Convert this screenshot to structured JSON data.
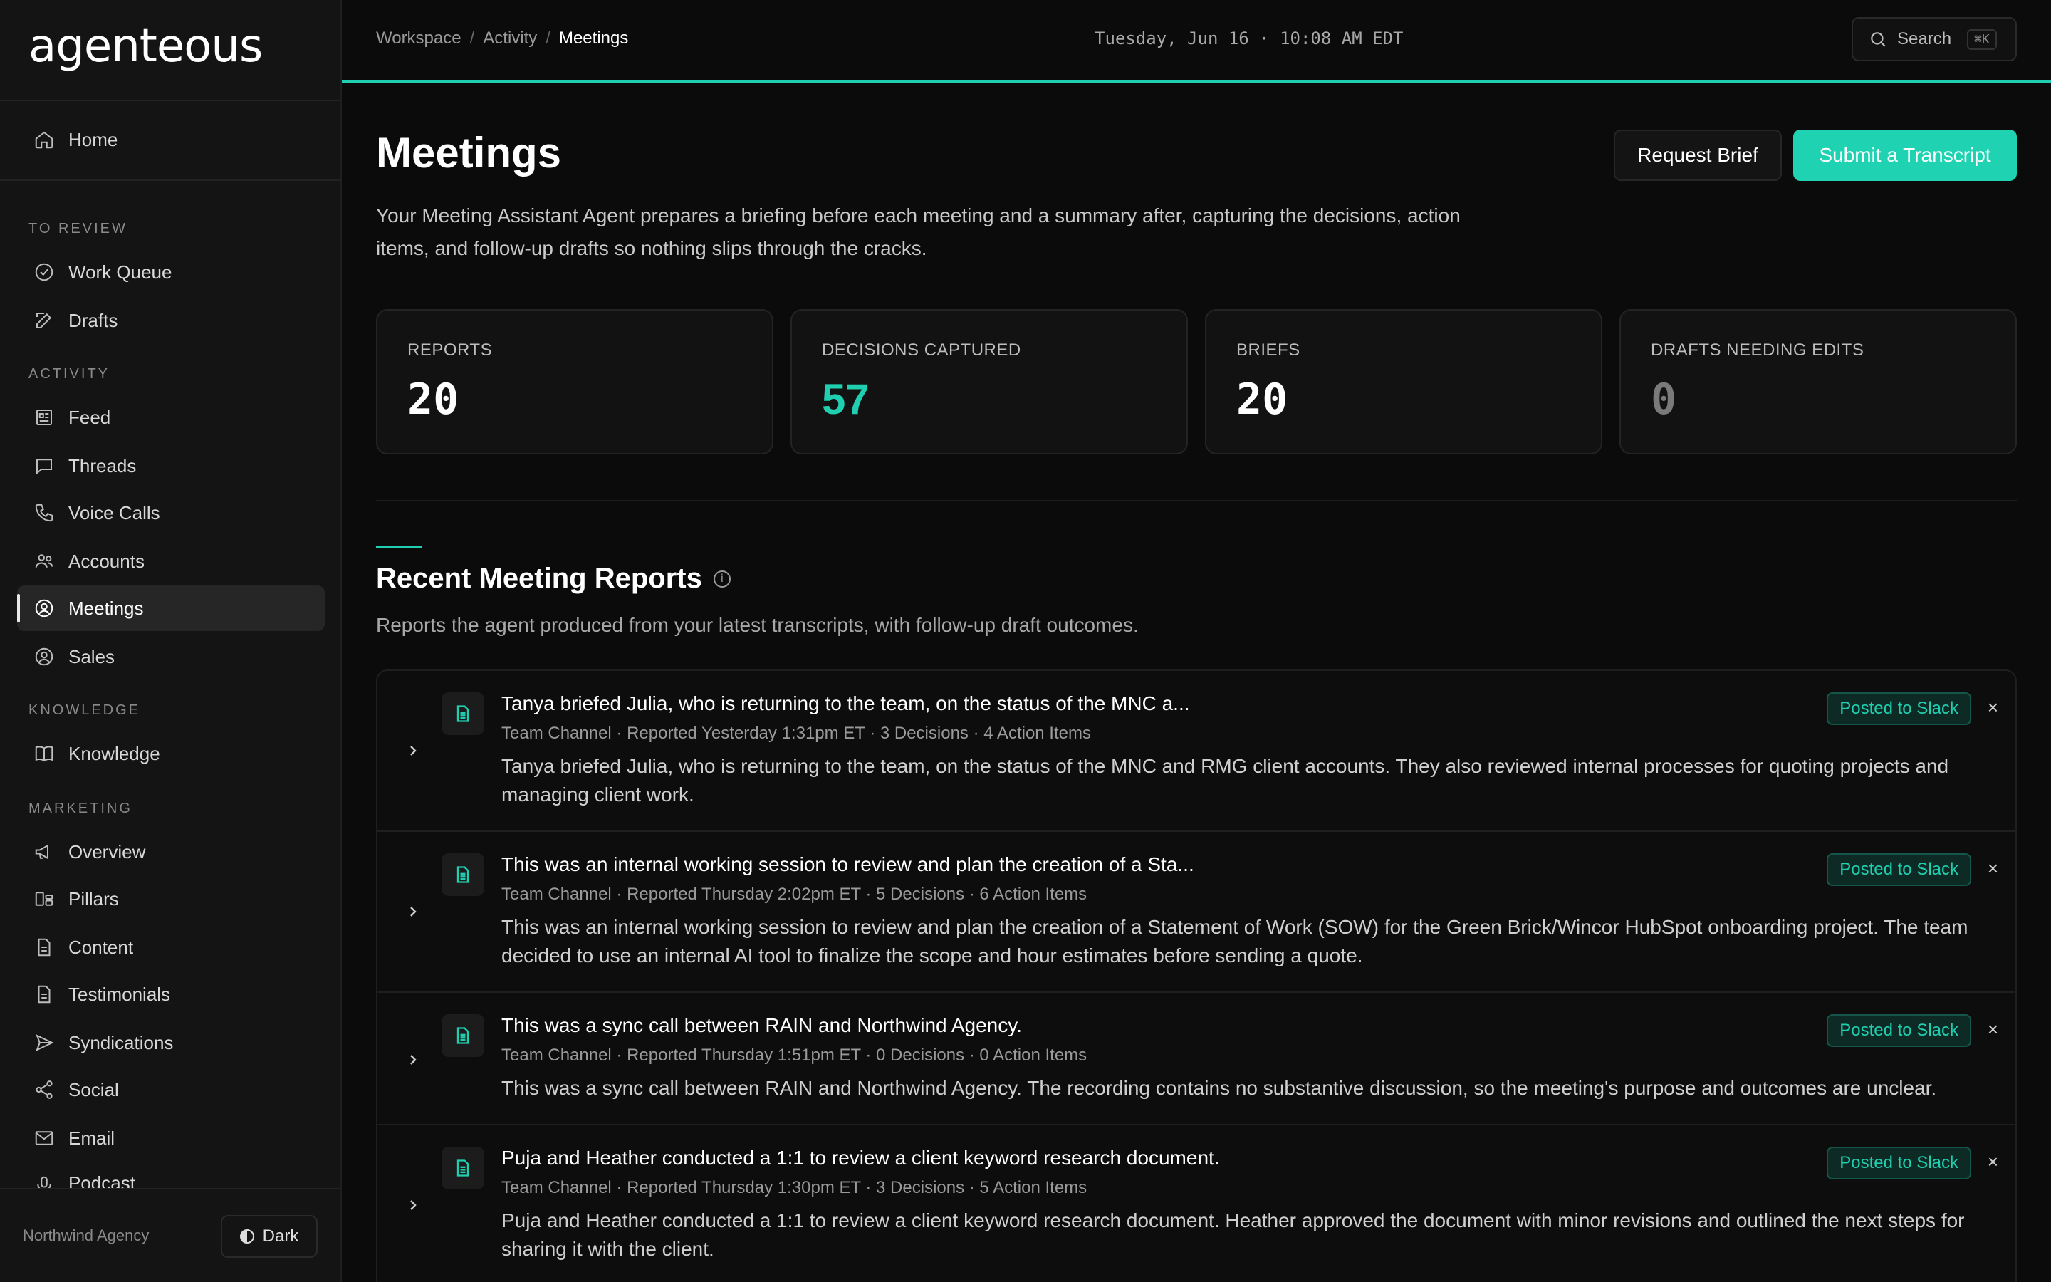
{
  "app": {
    "logo": "agenteous",
    "org_name": "Northwind Agency",
    "theme_label": "Dark"
  },
  "sidebar": {
    "home": "Home",
    "sections": {
      "to_review": "TO REVIEW",
      "activity": "ACTIVITY",
      "knowledge": "KNOWLEDGE",
      "marketing": "MARKETING"
    },
    "items": {
      "work_queue": "Work Queue",
      "drafts": "Drafts",
      "feed": "Feed",
      "threads": "Threads",
      "voice_calls": "Voice Calls",
      "accounts": "Accounts",
      "meetings": "Meetings",
      "sales": "Sales",
      "knowledge": "Knowledge",
      "overview": "Overview",
      "pillars": "Pillars",
      "content": "Content",
      "testimonials": "Testimonials",
      "syndications": "Syndications",
      "social": "Social",
      "email": "Email",
      "podcast": "Podcast"
    }
  },
  "topbar": {
    "breadcrumb": [
      "Workspace",
      "Activity",
      "Meetings"
    ],
    "separator": "/",
    "datetime": "Tuesday, Jun 16 · 10:08 AM EDT",
    "search_label": "Search",
    "search_shortcut": "⌘K"
  },
  "page": {
    "title": "Meetings",
    "description": "Your Meeting Assistant Agent prepares a briefing before each meeting and a summary after, capturing the decisions, action items, and follow-up drafts so nothing slips through the cracks.",
    "request_brief": "Request Brief",
    "submit_transcript": "Submit a Transcript"
  },
  "stats": [
    {
      "label": "REPORTS",
      "value": "20"
    },
    {
      "label": "DECISIONS CAPTURED",
      "value": "57"
    },
    {
      "label": "BRIEFS",
      "value": "20"
    },
    {
      "label": "DRAFTS NEEDING EDITS",
      "value": "0"
    }
  ],
  "reports_section": {
    "title": "Recent Meeting Reports",
    "info_icon": "i",
    "description": "Reports the agent produced from your latest transcripts, with follow-up draft outcomes."
  },
  "reports": [
    {
      "title": "Tanya briefed Julia, who is returning to the team, on the status of the MNC a...",
      "meta": "Team Channel · Reported Yesterday 1:31pm ET · 3 Decisions · 4 Action Items",
      "summary": "Tanya briefed Julia, who is returning to the team, on the status of the MNC and RMG client accounts. They also reviewed internal processes for quoting projects and managing client work.",
      "badge": "Posted to Slack",
      "close": "×"
    },
    {
      "title": "This was an internal working session to review and plan the creation of a Sta...",
      "meta": "Team Channel · Reported Thursday 2:02pm ET · 5 Decisions · 6 Action Items",
      "summary": "This was an internal working session to review and plan the creation of a Statement of Work (SOW) for the Green Brick/Wincor HubSpot onboarding project. The team decided to use an internal AI tool to finalize the scope and hour estimates before sending a quote.",
      "badge": "Posted to Slack",
      "close": "×"
    },
    {
      "title": "This was a sync call between RAIN and Northwind Agency.",
      "meta": "Team Channel · Reported Thursday 1:51pm ET · 0 Decisions · 0 Action Items",
      "summary": "This was a sync call between RAIN and Northwind Agency. The recording contains no substantive discussion, so the meeting's purpose and outcomes are unclear.",
      "badge": "Posted to Slack",
      "close": "×"
    },
    {
      "title": "Puja and Heather conducted a 1:1 to review a client keyword research document.",
      "meta": "Team Channel · Reported Thursday 1:30pm ET · 3 Decisions · 5 Action Items",
      "summary": "Puja and Heather conducted a 1:1 to review a client keyword research document. Heather approved the document with minor revisions and outlined the next steps for sharing it with the client.",
      "badge": "Posted to Slack",
      "close": "×"
    }
  ],
  "colors": {
    "accent": "#1fcfb0",
    "background": "#0b0b0b",
    "sidebar": "#141414"
  }
}
